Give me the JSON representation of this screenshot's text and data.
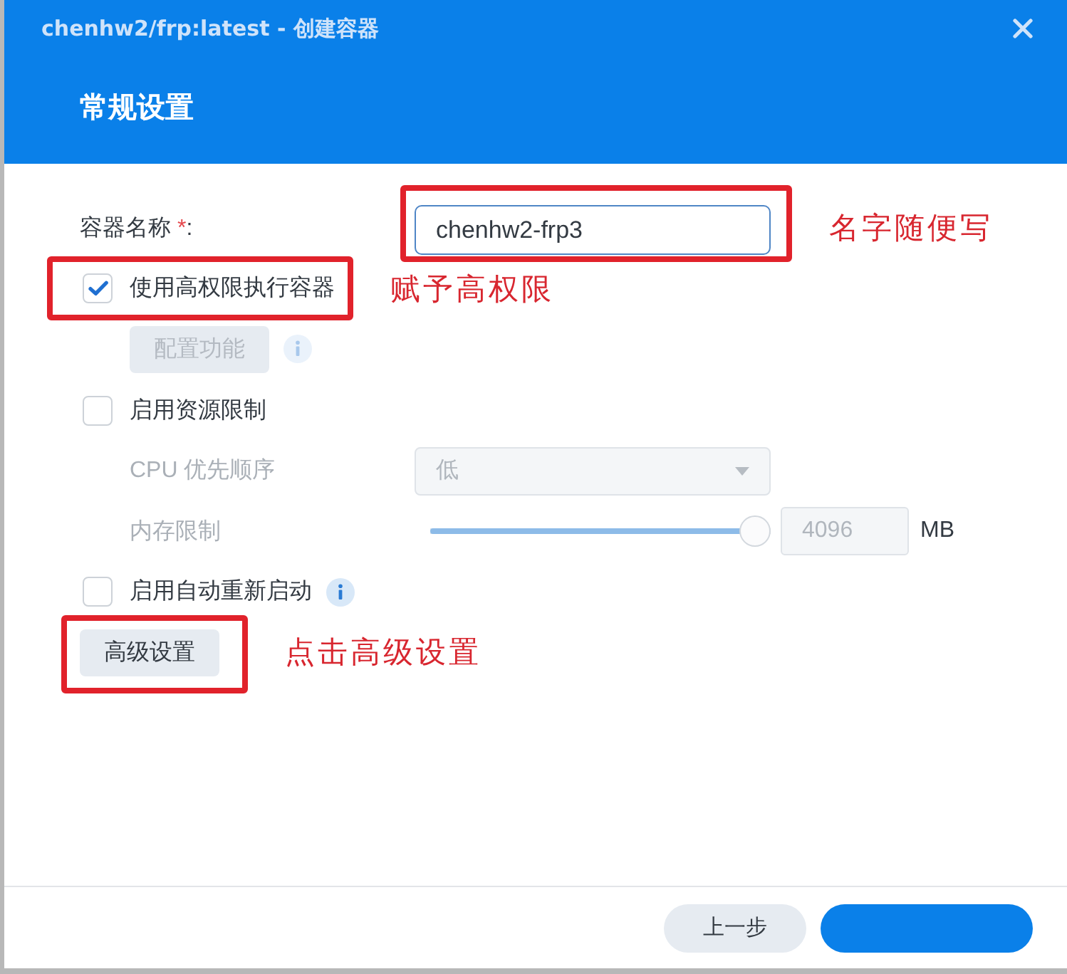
{
  "window": {
    "title": "chenhw2/frp:latest - 创建容器"
  },
  "section": {
    "title": "常规设置"
  },
  "name_field": {
    "label": "容器名称",
    "required_mark": "*",
    "colon": ":",
    "value": "chenhw2-frp3",
    "highlighted": true,
    "note": "名字随便写"
  },
  "settings": [
    {
      "kind": "checkbox",
      "label": "使用高权限执行容器",
      "checked": true,
      "highlighted": true,
      "note": "赋予高权限",
      "children": [
        {
          "kind": "button",
          "label": "配置功能",
          "disabled": true,
          "info": true
        }
      ]
    },
    {
      "kind": "checkbox",
      "label": "启用资源限制",
      "checked": false,
      "children": [
        {
          "kind": "select",
          "label": "CPU 优先顺序",
          "value": "低",
          "disabled": true
        },
        {
          "kind": "slider",
          "label": "内存限制",
          "level": 1,
          "value": "4096",
          "unit": "MB",
          "disabled": true
        }
      ]
    },
    {
      "kind": "checkbox",
      "label": "启用自动重新启动",
      "checked": false,
      "info": true
    },
    {
      "kind": "button",
      "label": "高级设置",
      "disabled": false,
      "highlighted": true,
      "note": "点击高级设置"
    }
  ],
  "footer": {
    "buttons": [
      {
        "kind": "secondary",
        "label": "上一步"
      },
      {
        "kind": "primary"
      }
    ]
  }
}
